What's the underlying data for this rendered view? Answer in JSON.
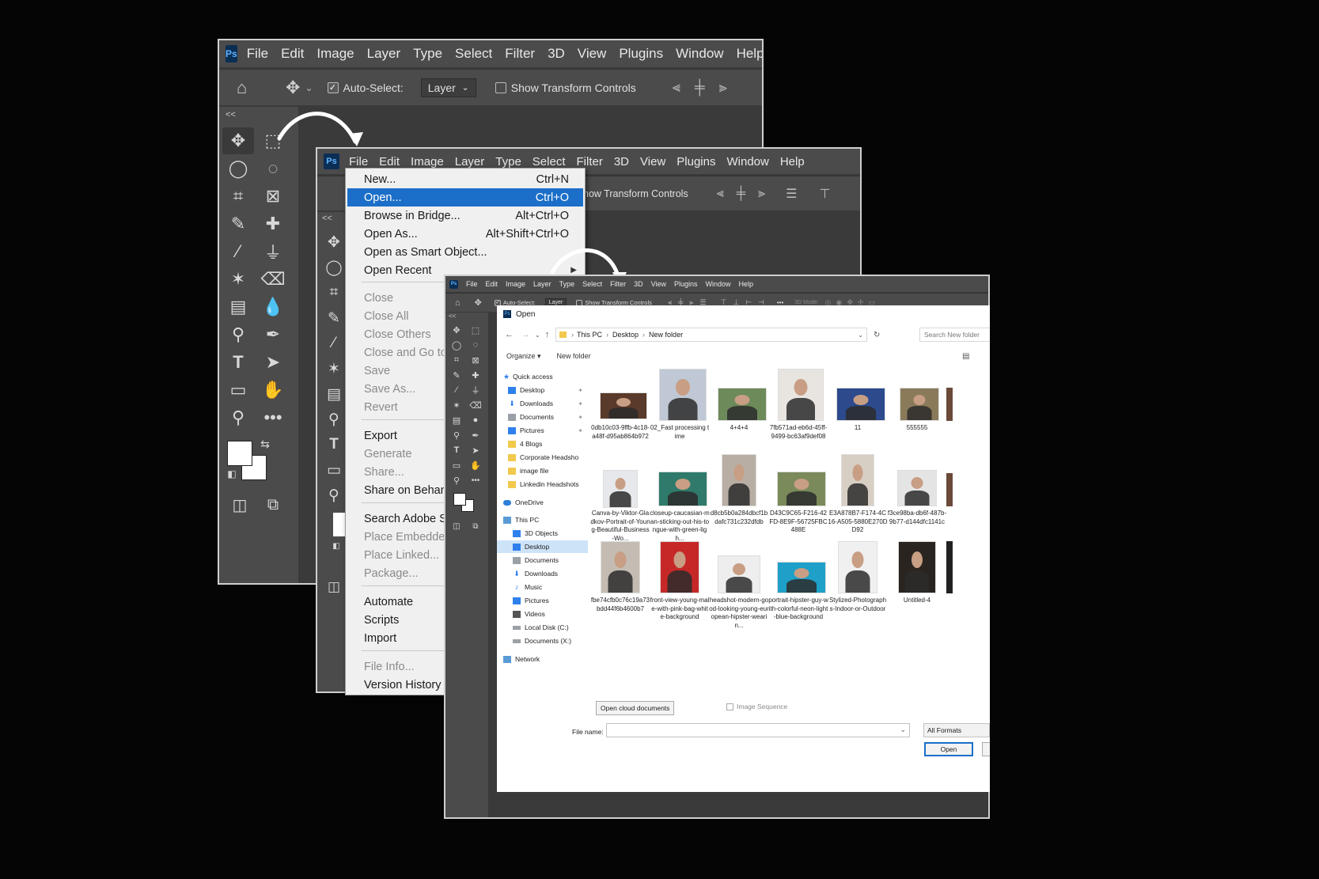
{
  "app": {
    "logo": "Ps"
  },
  "menubar": [
    "File",
    "Edit",
    "Image",
    "Layer",
    "Type",
    "Select",
    "Filter",
    "3D",
    "View",
    "Plugins",
    "Window",
    "Help"
  ],
  "options_bar": {
    "auto_select_label": "Auto-Select:",
    "layer_select_value": "Layer",
    "show_transform_label": "Show Transform Controls",
    "show_transform_partial": "how Transform Controls",
    "mini_show_transform_label": "Show Transform Controls",
    "mini_3d_mode": "3D Mode:",
    "mini_more": "•••"
  },
  "collapse_glyph": "<<",
  "file_menu": {
    "items": [
      {
        "label": "New...",
        "shortcut": "Ctrl+N"
      },
      {
        "label": "Open...",
        "shortcut": "Ctrl+O"
      },
      {
        "label": "Browse in Bridge...",
        "shortcut": "Alt+Ctrl+O"
      },
      {
        "label": "Open As...",
        "shortcut": "Alt+Shift+Ctrl+O"
      },
      {
        "label": "Open as Smart Object...",
        "shortcut": ""
      },
      {
        "label": "Open Recent",
        "shortcut": ""
      },
      {
        "label": "Close",
        "shortcut": ""
      },
      {
        "label": "Close All",
        "shortcut": ""
      },
      {
        "label": "Close Others",
        "shortcut": ""
      },
      {
        "label": "Close and Go to",
        "shortcut": ""
      },
      {
        "label": "Save",
        "shortcut": ""
      },
      {
        "label": "Save As...",
        "shortcut": ""
      },
      {
        "label": "Revert",
        "shortcut": ""
      },
      {
        "label": "Export",
        "shortcut": ""
      },
      {
        "label": "Generate",
        "shortcut": ""
      },
      {
        "label": "Share...",
        "shortcut": ""
      },
      {
        "label": "Share on Behan",
        "shortcut": ""
      },
      {
        "label": "Search Adobe St",
        "shortcut": ""
      },
      {
        "label": "Place Embedded",
        "shortcut": ""
      },
      {
        "label": "Place Linked...",
        "shortcut": ""
      },
      {
        "label": "Package...",
        "shortcut": ""
      },
      {
        "label": "Automate",
        "shortcut": ""
      },
      {
        "label": "Scripts",
        "shortcut": ""
      },
      {
        "label": "Import",
        "shortcut": ""
      },
      {
        "label": "File Info...",
        "shortcut": ""
      },
      {
        "label": "Version History",
        "shortcut": ""
      }
    ]
  },
  "open_dialog": {
    "title": "Open",
    "breadcrumb": [
      "This PC",
      "Desktop",
      "New folder"
    ],
    "search_placeholder": "Search New folder",
    "organize_label": "Organize ▾",
    "new_folder_label": "New folder",
    "nav": [
      {
        "label": "Quick access"
      },
      {
        "label": "Desktop"
      },
      {
        "label": "Downloads"
      },
      {
        "label": "Documents"
      },
      {
        "label": "Pictures"
      },
      {
        "label": "4 Blogs"
      },
      {
        "label": "Corporate Headsho"
      },
      {
        "label": "image file"
      },
      {
        "label": "Linkedin Headshots"
      },
      {
        "label": "OneDrive"
      },
      {
        "label": "This PC"
      },
      {
        "label": "3D Objects"
      },
      {
        "label": "Desktop"
      },
      {
        "label": "Documents"
      },
      {
        "label": "Downloads"
      },
      {
        "label": "Music"
      },
      {
        "label": "Pictures"
      },
      {
        "label": "Videos"
      },
      {
        "label": "Local Disk (C:)"
      },
      {
        "label": "Documents (X:)"
      },
      {
        "label": "Network"
      }
    ],
    "files": [
      {
        "name": "0db10c03-9ffb-4c18-a48f-d95ab864b972",
        "color": "#5a3a2a"
      },
      {
        "name": "02_Fast processing time",
        "color": "#bfc8d4"
      },
      {
        "name": "4+4+4",
        "color": "#6d8a5a"
      },
      {
        "name": "7fb571ad-eb6d-45ff-9499-bc63af9def08",
        "color": "#e8e4e0"
      },
      {
        "name": "11",
        "color": "#2c4a8c"
      },
      {
        "name": "555555",
        "color": "#8a7a5a"
      },
      {
        "name": "Canva-by-Viktor-Gladkov-Portrait-of-Young-Beautiful-Business-Wo...",
        "color": "#e6e8ec"
      },
      {
        "name": "closeup-caucasian-man-sticking-out-his-tongue-with-green-ligh...",
        "color": "#2f7a6a"
      },
      {
        "name": "d8cb5b0a284dbcf1bdafc731c232dfdb",
        "color": "#b8aea4"
      },
      {
        "name": "D43C9C65-F216-42FD-8E9F-56725FBC488E",
        "color": "#7a8a5a"
      },
      {
        "name": "E3A878B7-F174-4C16-A505-5880E270DD92",
        "color": "#d8cfc4"
      },
      {
        "name": "f3ce98ba-db6f-487b-9b77-d144dfc1141c",
        "color": "#e4e4e4"
      },
      {
        "name": "fbe74cfb0c76c19a73bdd44f6b4600b7",
        "color": "#c4bcb2"
      },
      {
        "name": "front-view-young-male-with-pink-bag-white-background",
        "color": "#c62828"
      },
      {
        "name": "headshot-modern-good-looking-young-european-hipster-wearin...",
        "color": "#eeeeee"
      },
      {
        "name": "portrait-hipster-guy-with-colorful-neon-light-blue-background",
        "color": "#1ea0c8"
      },
      {
        "name": "Stylized-Photographs-Indoor-or-Outdoor",
        "color": "#f0f0f0"
      },
      {
        "name": "Untitled-4",
        "color": "#2a2420"
      }
    ],
    "open_cloud_label": "Open cloud documents",
    "image_sequence_label": "Image Sequence",
    "file_name_label": "File name:",
    "file_name_value": "",
    "format_value": "All Formats",
    "open_button_label": "Open"
  },
  "colors": {
    "ps_blue": "#1c6fc8",
    "ps_panel": "#3a3a3a",
    "ps_bar": "#4b4b4b"
  }
}
